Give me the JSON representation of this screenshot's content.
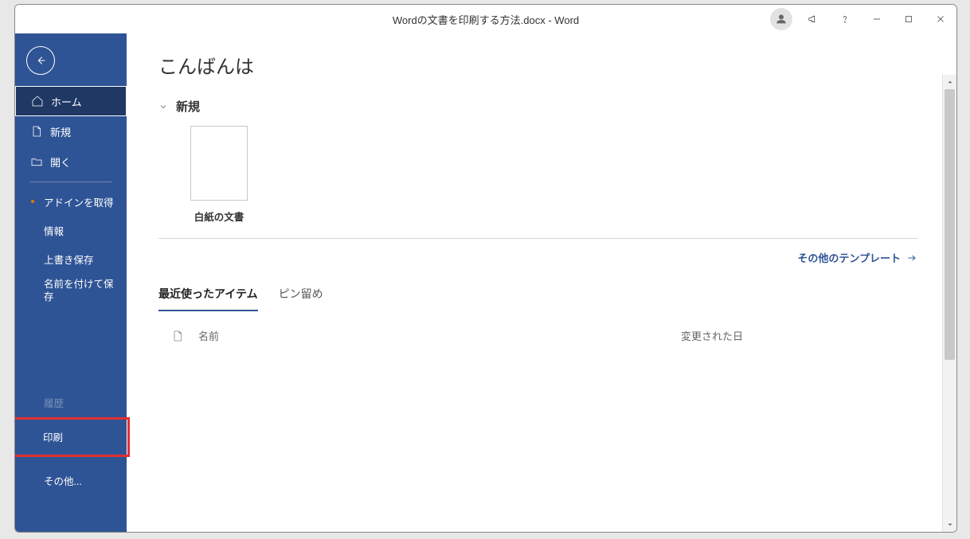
{
  "title": "Wordの文書を印刷する方法.docx  -  Word",
  "greeting": "こんばんは",
  "sidebar": {
    "home": "ホーム",
    "new": "新規",
    "open": "開く",
    "get_addins": "アドインを取得",
    "info": "情報",
    "save": "上書き保存",
    "save_as": "名前を付けて保存",
    "history": "履歴",
    "print": "印刷",
    "other": "その他..."
  },
  "sections": {
    "new": "新規",
    "blank_doc": "白紙の文書",
    "more_templates": "その他のテンプレート"
  },
  "tabs": {
    "recent": "最近使ったアイテム",
    "pinned": "ピン留め"
  },
  "list": {
    "col_name": "名前",
    "col_date": "変更された日"
  }
}
